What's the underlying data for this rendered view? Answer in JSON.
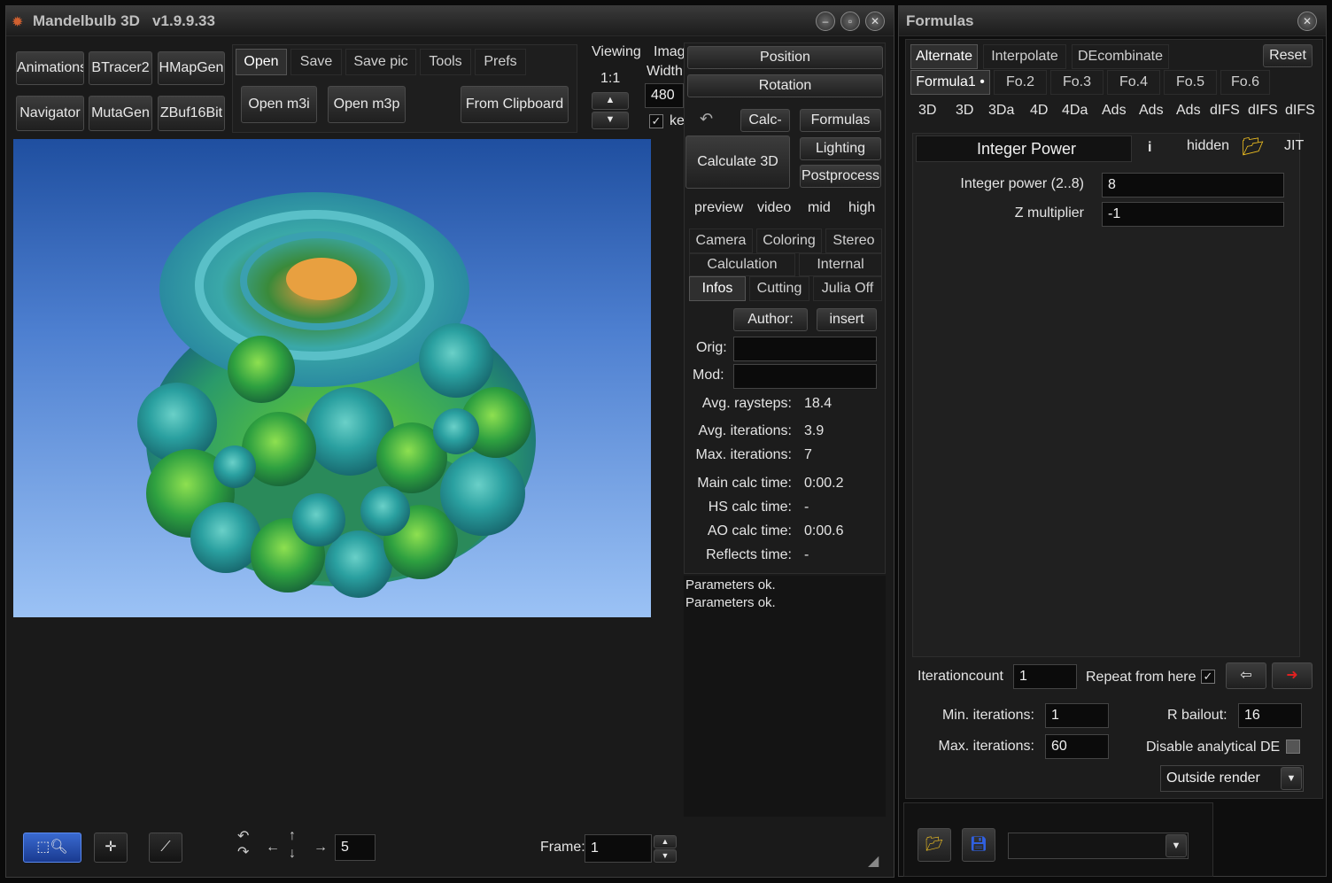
{
  "main": {
    "title": "Mandelbulb 3D   v1.9.9.33",
    "tools": {
      "animations": "Animations",
      "btracer2": "BTracer2",
      "hmapgen": "HMapGen",
      "navigator": "Navigator",
      "mutagen": "MutaGen",
      "zbuf16bit": "ZBuf16Bit"
    },
    "file_tabs": [
      "Open",
      "Save",
      "Save pic",
      "Tools",
      "Prefs"
    ],
    "open_m3i": "Open m3i",
    "open_m3p": "Open m3p",
    "from_clipboard": "From Clipboard",
    "viewing_label": "Viewing",
    "viewing_value": "1:1",
    "image_label": "Imag",
    "width_label": "Width",
    "width_value": "480",
    "keep_label": "ke",
    "position": "Position",
    "rotation": "Rotation",
    "calc_minus": "Calc-",
    "formulas": "Formulas",
    "calculate_3d": "Calculate 3D",
    "lighting": "Lighting",
    "postprocess": "Postprocess",
    "quality": [
      "preview",
      "video",
      "mid",
      "high"
    ],
    "tabs_row1": [
      "Camera",
      "Coloring",
      "Stereo"
    ],
    "tabs_row2": [
      "Calculation",
      "Internal"
    ],
    "tabs_row3": [
      "Infos",
      "Cutting",
      "Julia Off"
    ],
    "author_btn": "Author:",
    "insert_btn": "insert",
    "orig_label": "Orig:",
    "mod_label": "Mod:",
    "stats": [
      {
        "label": "Avg. raysteps:",
        "value": "18.4"
      },
      {
        "label": "Avg. iterations:",
        "value": "3.9"
      },
      {
        "label": "Max. iterations:",
        "value": "7"
      },
      {
        "label": "Main calc time:",
        "value": "0:00.2"
      },
      {
        "label": "HS calc time:",
        "value": "-"
      },
      {
        "label": "AO calc time:",
        "value": "0:00.6"
      },
      {
        "label": "Reflects time:",
        "value": "-"
      }
    ],
    "log": [
      "Parameters ok.",
      "Parameters ok."
    ],
    "step_value": "5",
    "frame_label": "Frame:",
    "frame_value": "1"
  },
  "formulas_win": {
    "title": "Formulas",
    "top_tabs": [
      "Alternate",
      "Interpolate",
      "DEcombinate"
    ],
    "reset": "Reset",
    "formula_tabs": [
      "Formula1 •",
      "Fo.2",
      "Fo.3",
      "Fo.4",
      "Fo.5",
      "Fo.6"
    ],
    "dim_labels": [
      "3D",
      "3D",
      "3Da",
      "4D",
      "4Da",
      "Ads",
      "Ads",
      "Ads",
      "dIFS",
      "dIFS",
      "dIFS"
    ],
    "formula_name": "Integer Power",
    "info": "i",
    "hidden": "hidden",
    "jit": "JIT",
    "params": [
      {
        "label": "Integer power (2..8)",
        "value": "8"
      },
      {
        "label": "Z multiplier",
        "value": "-1"
      }
    ],
    "iterationcount_label": "Iterationcount",
    "iterationcount_value": "1",
    "repeat_label": "Repeat from here",
    "min_iter_label": "Min. iterations:",
    "min_iter_value": "1",
    "max_iter_label": "Max. iterations:",
    "max_iter_value": "60",
    "rbailout_label": "R bailout:",
    "rbailout_value": "16",
    "disable_de_label": "Disable analytical DE",
    "outside_render": "Outside render"
  }
}
